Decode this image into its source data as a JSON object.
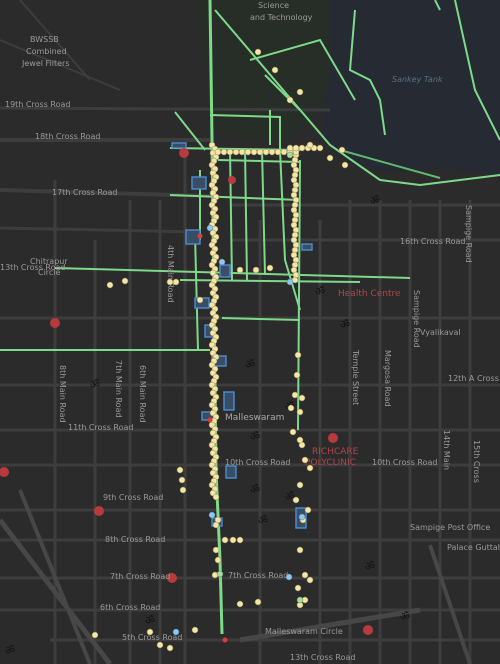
{
  "map": {
    "labels": {
      "science": "Science",
      "technology": "and Technology",
      "bwssb": "BWSSB",
      "combined": "Combined",
      "jewel_filters": "Jewel Filters",
      "cross19": "19th Cross Road",
      "cross18": "18th Cross Road",
      "cross17": "17th Cross Road",
      "cross16": "16th Cross Road",
      "cross13": "13th Cross Road",
      "cross12a": "12th A Cross",
      "cross11": "11th Cross Road",
      "cross10": "10th Cross Road",
      "cross9": "9th Cross Road",
      "cross8": "8th Cross Road",
      "cross7": "7th Cross Road",
      "cross6": "6th Cross Road",
      "cross5": "5th Cross Road",
      "cross13b": "13th Cross Road",
      "chitrapur": "Chitrapur",
      "circle": "Circle",
      "main4": "4th Main Road",
      "main8": "8th Main Road",
      "main6": "6th Main Road",
      "main7": "7th Main Road",
      "temple_street": "Temple Street",
      "margosa": "Margosa Road",
      "malleswaram": "Malleswaram",
      "malleswaram_circle": "Malleswaram Circle",
      "richcare": "RICHCARE",
      "polyclinic": "POLYCLINIC",
      "health_centre": "Health Centre",
      "sampige": "Sampige Road",
      "road_sampige": "Sampige Road",
      "sampige_post": "Sampige Post Office",
      "vyalikaval": "Vyalikaval",
      "palace_guttahalli": "Palace Guttahalli",
      "water_lbl": "Sankey Tank",
      "street_14": "14th Main",
      "cross15": "15th Cross"
    }
  }
}
